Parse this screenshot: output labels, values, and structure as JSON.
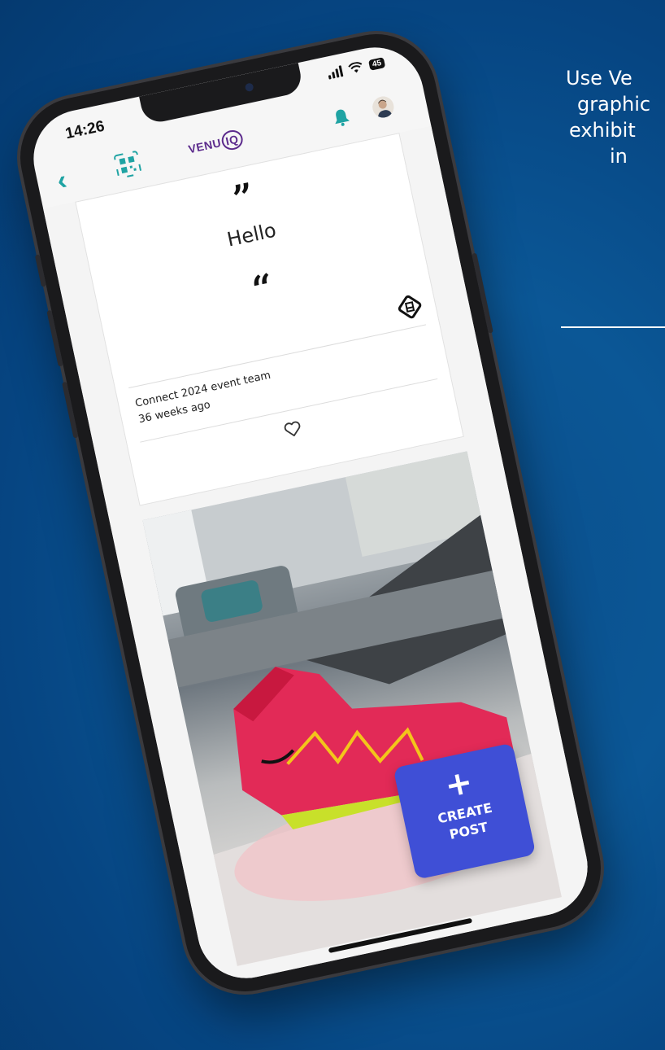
{
  "promo": {
    "lines": [
      "Use Ve",
      "graphic",
      "exhibit",
      "in"
    ]
  },
  "status_bar": {
    "time": "14:26",
    "battery": "45"
  },
  "app": {
    "logo_prefix": "VENU",
    "logo_suffix": "IQ"
  },
  "post": {
    "quote_close": "”",
    "text": "Hello",
    "quote_open": "“",
    "author": "Connect 2024 event team",
    "time_ago": "36 weeks ago"
  },
  "fab": {
    "label": "CREATE POST"
  },
  "icons": {
    "back": "chevron-left-icon",
    "qr": "qr-code-icon",
    "bell": "bell-icon",
    "avatar": "avatar",
    "bookmark": "bookmark-icon",
    "like": "heart-icon",
    "create": "plus-icon"
  },
  "colors": {
    "background": "#0b5796",
    "accent_teal": "#1fa3a3",
    "logo_purple": "#5b2a8c",
    "fab_blue": "#3f4fd6"
  }
}
